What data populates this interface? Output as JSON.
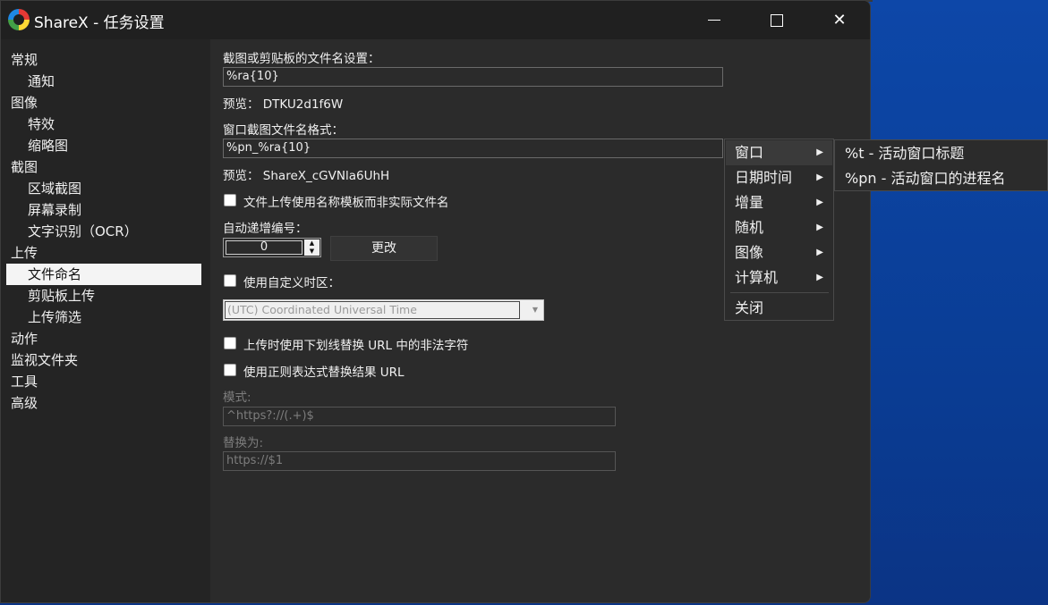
{
  "window": {
    "title": "ShareX - 任务设置"
  },
  "sidebar": {
    "items": [
      {
        "label": "常规"
      },
      {
        "label": "通知"
      },
      {
        "label": "图像"
      },
      {
        "label": "特效"
      },
      {
        "label": "缩略图"
      },
      {
        "label": "截图"
      },
      {
        "label": "区域截图"
      },
      {
        "label": "屏幕录制"
      },
      {
        "label": "文字识别（OCR）"
      },
      {
        "label": "上传"
      },
      {
        "label": "文件命名"
      },
      {
        "label": "剪贴板上传"
      },
      {
        "label": "上传筛选"
      },
      {
        "label": "动作"
      },
      {
        "label": "监视文件夹"
      },
      {
        "label": "工具"
      },
      {
        "label": "高级"
      }
    ]
  },
  "main": {
    "name_pattern_label": "截图或剪贴板的文件名设置：",
    "name_pattern_value": "%ra{10}",
    "name_preview": "预览：  DTKU2d1f6W",
    "window_pattern_label": "窗口截图文件名格式：",
    "window_pattern_value": "%pn_%ra{10}",
    "window_preview": "预览：  ShareX_cGVNla6UhH",
    "use_template_label": "文件上传使用名称模板而非实际文件名",
    "auto_increment_label": "自动递增编号：",
    "auto_increment_value": "0",
    "change_button": "更改",
    "custom_timezone_label": "使用自定义时区：",
    "timezone_value": "(UTC) Coordinated Universal Time",
    "replace_illegal_label": "上传时使用下划线替换 URL 中的非法字符",
    "regex_replace_label": "使用正则表达式替换结果 URL",
    "pattern_label": "模式:",
    "pattern_value": "^https?://(.+)$",
    "replace_with_label": "替换为:",
    "replace_with_value": "https://$1"
  },
  "context_menu": {
    "items": [
      {
        "label": "窗口"
      },
      {
        "label": "日期时间"
      },
      {
        "label": "增量"
      },
      {
        "label": "随机"
      },
      {
        "label": "图像"
      },
      {
        "label": "计算机"
      },
      {
        "label": "关闭"
      }
    ],
    "submenu": [
      {
        "label": "%t - 活动窗口标题"
      },
      {
        "label": "%pn - 活动窗口的进程名"
      }
    ]
  }
}
